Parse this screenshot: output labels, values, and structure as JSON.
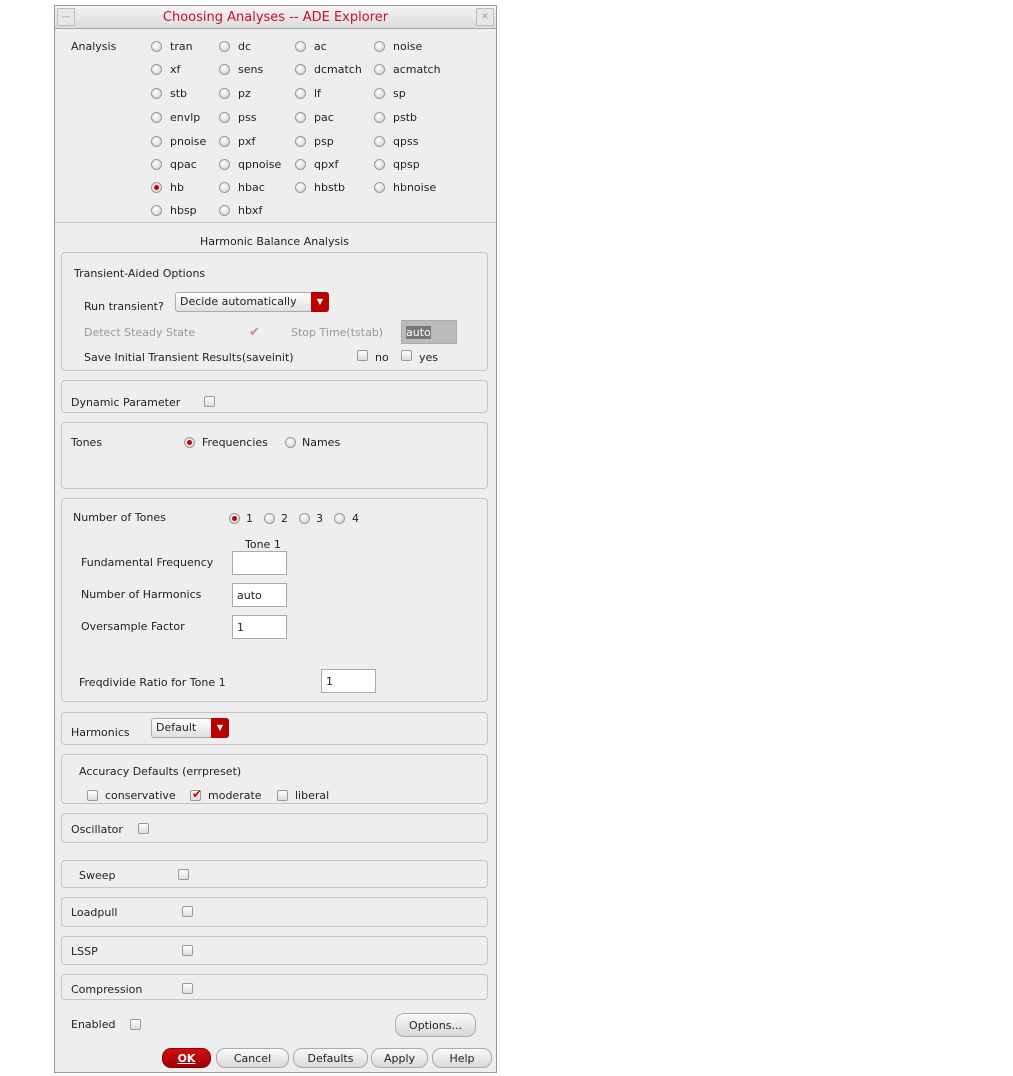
{
  "title": "Choosing Analyses -- ADE Explorer",
  "analysis": {
    "label": "Analysis",
    "selected": "hb",
    "options": [
      "tran",
      "dc",
      "ac",
      "noise",
      "xf",
      "sens",
      "dcmatch",
      "acmatch",
      "stb",
      "pz",
      "lf",
      "sp",
      "envlp",
      "pss",
      "pac",
      "pstb",
      "pnoise",
      "pxf",
      "psp",
      "qpss",
      "qpac",
      "qpnoise",
      "qpxf",
      "qpsp",
      "hb",
      "hbac",
      "hbstb",
      "hbnoise",
      "hbsp",
      "hbxf"
    ]
  },
  "section_title": "Harmonic Balance Analysis",
  "transient": {
    "title": "Transient-Aided Options",
    "run_label": "Run transient?",
    "run_value": "Decide automatically",
    "detect_label": "Detect Steady State",
    "detect_checked": true,
    "stop_label": "Stop Time(tstab)",
    "stop_value": "auto",
    "saveinit_label": "Save Initial Transient Results(saveinit)",
    "no": "no",
    "yes": "yes"
  },
  "dynamic": {
    "label": "Dynamic Parameter"
  },
  "tones": {
    "label": "Tones",
    "frequencies": "Frequencies",
    "names": "Names",
    "selected": "Frequencies"
  },
  "num_tones": {
    "label": "Number of Tones",
    "options": [
      "1",
      "2",
      "3",
      "4"
    ],
    "selected": "1",
    "tone_header": "Tone 1",
    "fund_label": "Fundamental Frequency",
    "fund_value": "",
    "harm_label": "Number of Harmonics",
    "harm_value": "auto",
    "over_label": "Oversample Factor",
    "over_value": "1",
    "freqdiv_label": "Freqdivide Ratio for Tone 1",
    "freqdiv_value": "1"
  },
  "harmonics": {
    "label": "Harmonics",
    "value": "Default"
  },
  "accuracy": {
    "label": "Accuracy Defaults (errpreset)",
    "conservative": "conservative",
    "moderate": "moderate",
    "liberal": "liberal",
    "selected": "moderate"
  },
  "oscillator": "Oscillator",
  "sweep": "Sweep",
  "loadpull": "Loadpull",
  "lssp": "LSSP",
  "compression": "Compression",
  "enabled": "Enabled",
  "options_btn": "Options...",
  "buttons": {
    "ok": "OK",
    "cancel": "Cancel",
    "defaults": "Defaults",
    "apply": "Apply",
    "help": "Help"
  }
}
